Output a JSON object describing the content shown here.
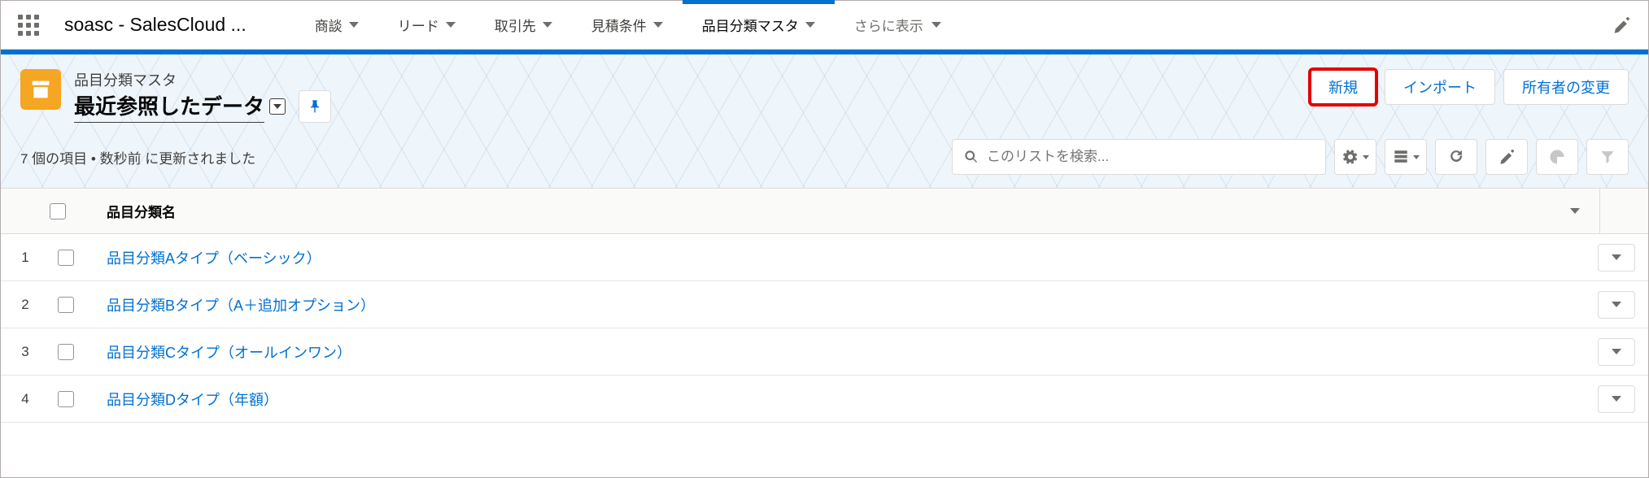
{
  "app": {
    "name": "soasc - SalesCloud ..."
  },
  "nav": {
    "tabs": [
      {
        "label": "商談"
      },
      {
        "label": "リード"
      },
      {
        "label": "取引先"
      },
      {
        "label": "見積条件"
      },
      {
        "label": "品目分類マスタ",
        "active": true
      }
    ],
    "more_label": "さらに表示"
  },
  "listview": {
    "object_label": "品目分類マスタ",
    "view_name": "最近参照したデータ",
    "meta_text": "7 個の項目 • 数秒前 に更新されました",
    "search_placeholder": "このリストを検索...",
    "actions": {
      "new_label": "新規",
      "import_label": "インポート",
      "change_owner_label": "所有者の変更"
    },
    "column_header": "品目分類名"
  },
  "rows": [
    {
      "idx": "1",
      "name": "品目分類Aタイプ（ベーシック）"
    },
    {
      "idx": "2",
      "name": "品目分類Bタイプ（A＋追加オプション）"
    },
    {
      "idx": "3",
      "name": "品目分類Cタイプ（オールインワン）"
    },
    {
      "idx": "4",
      "name": "品目分類Dタイプ（年額）"
    }
  ],
  "icons": {
    "app_launcher": "app-launcher-icon",
    "pencil": "pencil-icon",
    "archive": "archive-icon",
    "pin": "pin-icon",
    "search": "search-icon",
    "gear": "gear-icon",
    "table": "table-icon",
    "refresh": "refresh-icon",
    "edit": "edit-icon",
    "chart": "chart-icon",
    "filter": "filter-icon"
  }
}
